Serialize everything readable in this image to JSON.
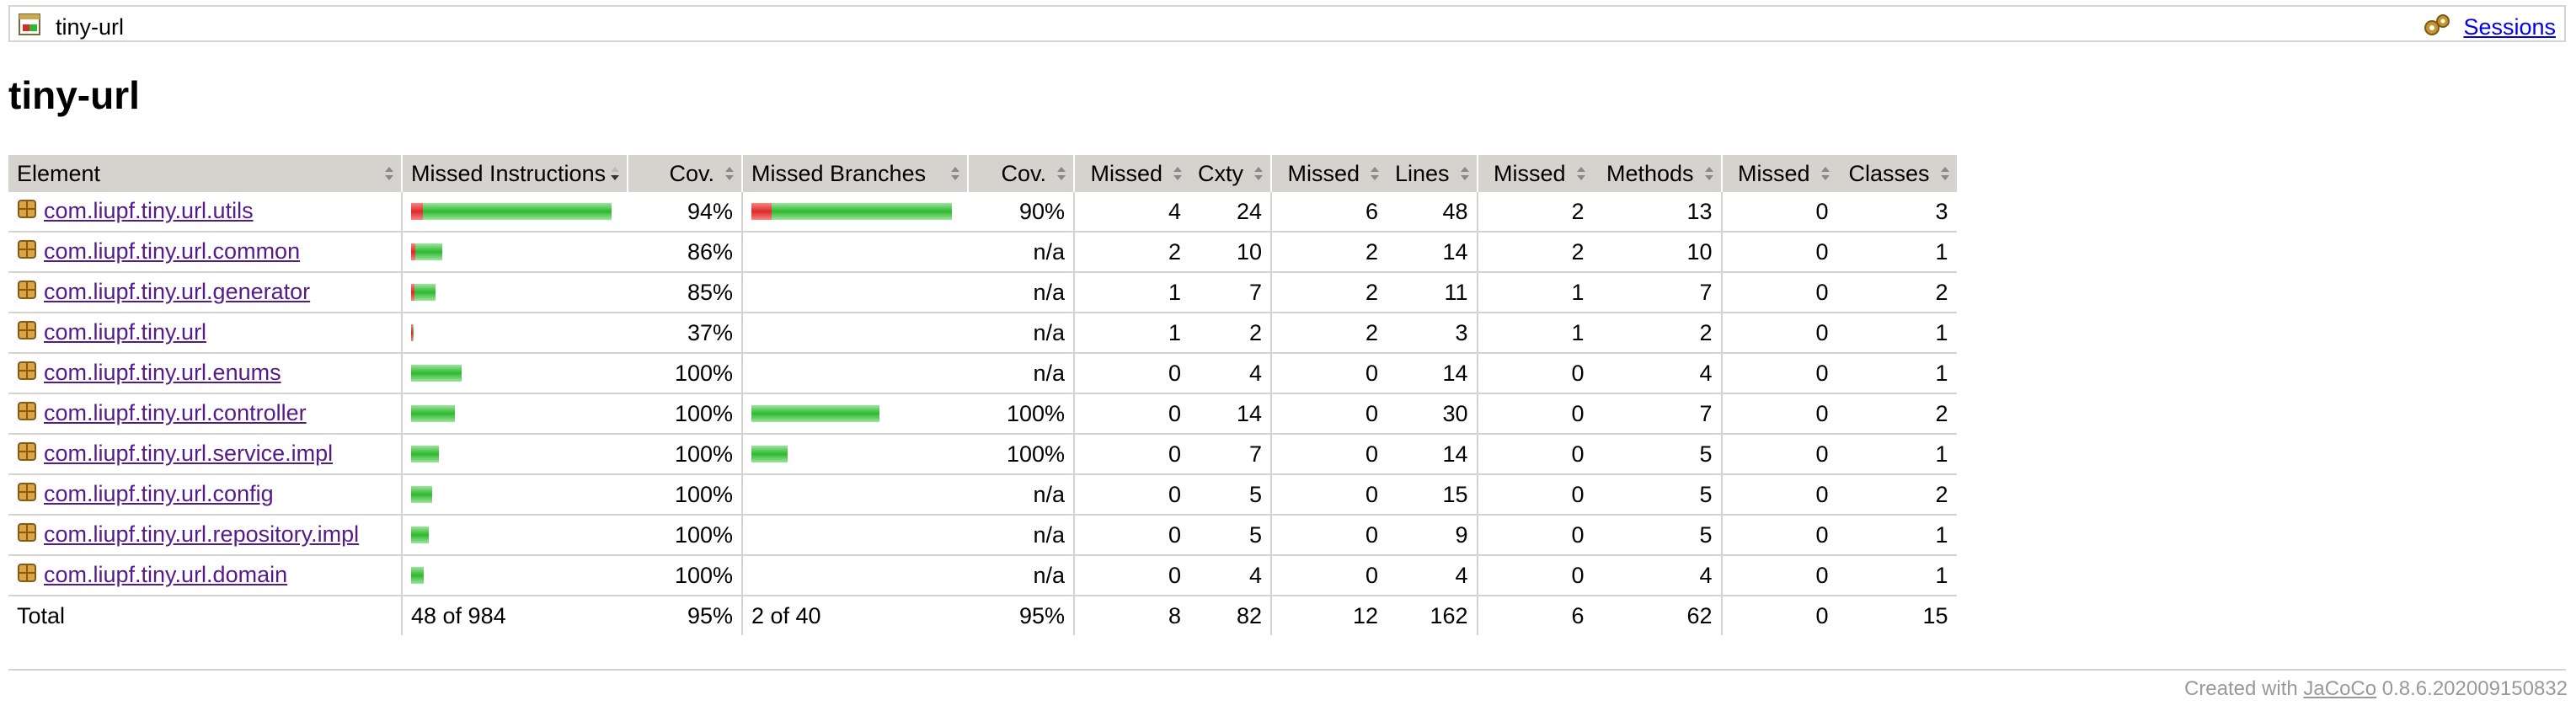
{
  "breadcrumb": {
    "title": "tiny-url",
    "sessions_link": "Sessions"
  },
  "page_title": "tiny-url",
  "table": {
    "headers": [
      "Element",
      "Missed Instructions",
      "Cov.",
      "Missed Branches",
      "Cov.",
      "Missed",
      "Cxty",
      "Missed",
      "Lines",
      "Missed",
      "Methods",
      "Missed",
      "Classes"
    ],
    "rows": [
      {
        "name": "com.liupf.tiny.url.utils",
        "instr_missed_frac": 0.06,
        "instr_bar_frac": 1.0,
        "instr_cov": "94%",
        "branch_present": true,
        "branch_missed_frac": 0.1,
        "branch_bar_frac": 1.0,
        "branch_cov": "90%",
        "cxty_missed": "4",
        "cxty": "24",
        "lines_missed": "6",
        "lines": "48",
        "methods_missed": "2",
        "methods": "13",
        "classes_missed": "0",
        "classes": "3"
      },
      {
        "name": "com.liupf.tiny.url.common",
        "instr_missed_frac": 0.14,
        "instr_bar_frac": 0.155,
        "instr_cov": "86%",
        "branch_present": false,
        "branch_cov": "n/a",
        "cxty_missed": "2",
        "cxty": "10",
        "lines_missed": "2",
        "lines": "14",
        "methods_missed": "2",
        "methods": "10",
        "classes_missed": "0",
        "classes": "1"
      },
      {
        "name": "com.liupf.tiny.url.generator",
        "instr_missed_frac": 0.15,
        "instr_bar_frac": 0.12,
        "instr_cov": "85%",
        "branch_present": false,
        "branch_cov": "n/a",
        "cxty_missed": "1",
        "cxty": "7",
        "lines_missed": "2",
        "lines": "11",
        "methods_missed": "1",
        "methods": "7",
        "classes_missed": "0",
        "classes": "2"
      },
      {
        "name": "com.liupf.tiny.url",
        "instr_missed_frac": 0.63,
        "instr_bar_frac": 0.013,
        "instr_cov": "37%",
        "branch_present": false,
        "branch_cov": "n/a",
        "cxty_missed": "1",
        "cxty": "2",
        "lines_missed": "2",
        "lines": "3",
        "methods_missed": "1",
        "methods": "2",
        "classes_missed": "0",
        "classes": "1"
      },
      {
        "name": "com.liupf.tiny.url.enums",
        "instr_missed_frac": 0,
        "instr_bar_frac": 0.25,
        "instr_cov": "100%",
        "branch_present": false,
        "branch_cov": "n/a",
        "cxty_missed": "0",
        "cxty": "4",
        "lines_missed": "0",
        "lines": "14",
        "methods_missed": "0",
        "methods": "4",
        "classes_missed": "0",
        "classes": "1"
      },
      {
        "name": "com.liupf.tiny.url.controller",
        "instr_missed_frac": 0,
        "instr_bar_frac": 0.22,
        "instr_cov": "100%",
        "branch_present": true,
        "branch_missed_frac": 0,
        "branch_bar_frac": 0.64,
        "branch_cov": "100%",
        "cxty_missed": "0",
        "cxty": "14",
        "lines_missed": "0",
        "lines": "30",
        "methods_missed": "0",
        "methods": "7",
        "classes_missed": "0",
        "classes": "2"
      },
      {
        "name": "com.liupf.tiny.url.service.impl",
        "instr_missed_frac": 0,
        "instr_bar_frac": 0.14,
        "instr_cov": "100%",
        "branch_present": true,
        "branch_missed_frac": 0,
        "branch_bar_frac": 0.18,
        "branch_cov": "100%",
        "cxty_missed": "0",
        "cxty": "7",
        "lines_missed": "0",
        "lines": "14",
        "methods_missed": "0",
        "methods": "5",
        "classes_missed": "0",
        "classes": "1"
      },
      {
        "name": "com.liupf.tiny.url.config",
        "instr_missed_frac": 0,
        "instr_bar_frac": 0.105,
        "instr_cov": "100%",
        "branch_present": false,
        "branch_cov": "n/a",
        "cxty_missed": "0",
        "cxty": "5",
        "lines_missed": "0",
        "lines": "15",
        "methods_missed": "0",
        "methods": "5",
        "classes_missed": "0",
        "classes": "2"
      },
      {
        "name": "com.liupf.tiny.url.repository.impl",
        "instr_missed_frac": 0,
        "instr_bar_frac": 0.09,
        "instr_cov": "100%",
        "branch_present": false,
        "branch_cov": "n/a",
        "cxty_missed": "0",
        "cxty": "5",
        "lines_missed": "0",
        "lines": "9",
        "methods_missed": "0",
        "methods": "5",
        "classes_missed": "0",
        "classes": "1"
      },
      {
        "name": "com.liupf.tiny.url.domain",
        "instr_missed_frac": 0,
        "instr_bar_frac": 0.065,
        "instr_cov": "100%",
        "branch_present": false,
        "branch_cov": "n/a",
        "cxty_missed": "0",
        "cxty": "4",
        "lines_missed": "0",
        "lines": "4",
        "methods_missed": "0",
        "methods": "4",
        "classes_missed": "0",
        "classes": "1"
      }
    ],
    "total": {
      "label": "Total",
      "instr": "48 of 984",
      "instr_cov": "95%",
      "branch": "2 of 40",
      "branch_cov": "95%",
      "cxty_missed": "8",
      "cxty": "82",
      "lines_missed": "12",
      "lines": "162",
      "methods_missed": "6",
      "methods": "62",
      "classes_missed": "0",
      "classes": "15"
    }
  },
  "footer": {
    "prefix": "Created with ",
    "link": "JaCoCo",
    "suffix": " 0.8.6.202009150832"
  }
}
